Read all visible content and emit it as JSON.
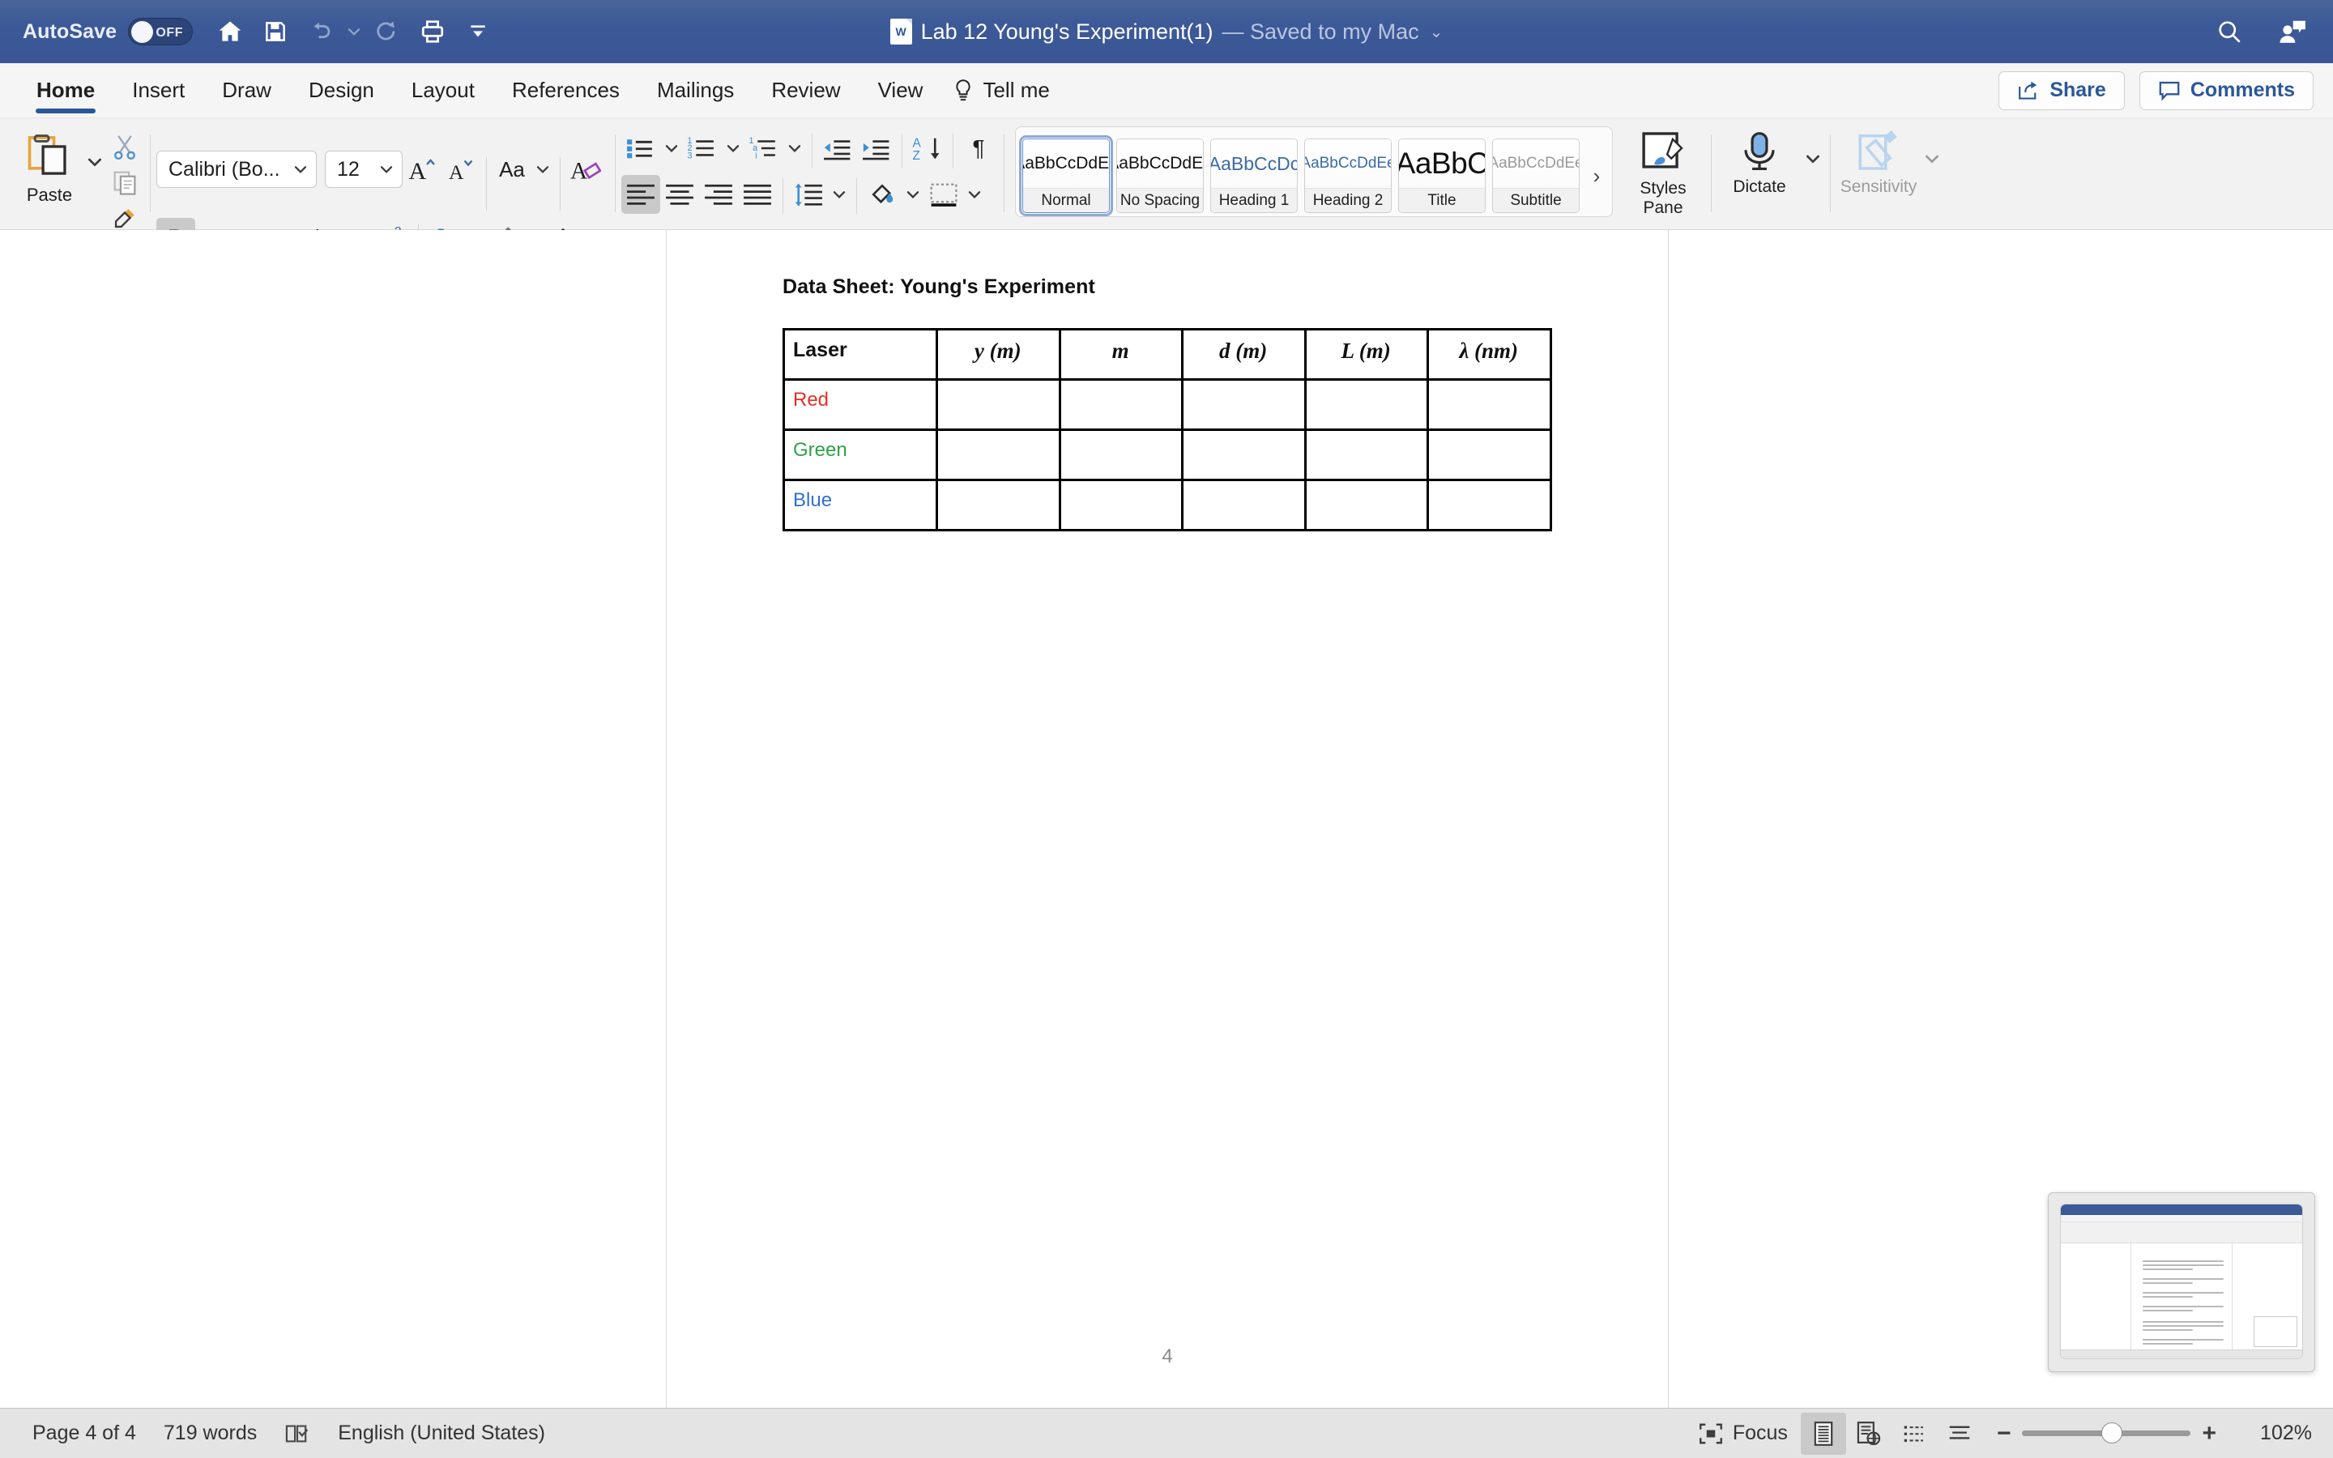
{
  "titlebar": {
    "autosave_label": "AutoSave",
    "autosave_state": "OFF",
    "quick_access": [
      {
        "name": "home-icon",
        "label": "Home"
      },
      {
        "name": "save-icon",
        "label": "Save"
      },
      {
        "name": "undo-icon",
        "label": "Undo"
      },
      {
        "name": "redo-icon",
        "label": "Redo"
      },
      {
        "name": "print-icon",
        "label": "Print"
      },
      {
        "name": "customize-toolbar-icon",
        "label": "Customize Quick Access Toolbar"
      }
    ],
    "doc_icon_letter": "W",
    "doc_title": "Lab 12 Young's Experiment(1)",
    "save_status": " — Saved to my Mac",
    "title_caret": "⌄",
    "search_icon": "search-icon",
    "account_icon": "account-presence-icon"
  },
  "ribbon_tabs": {
    "items": [
      {
        "label": "Home",
        "active": true
      },
      {
        "label": "Insert",
        "active": false
      },
      {
        "label": "Draw",
        "active": false
      },
      {
        "label": "Design",
        "active": false
      },
      {
        "label": "Layout",
        "active": false
      },
      {
        "label": "References",
        "active": false
      },
      {
        "label": "Mailings",
        "active": false
      },
      {
        "label": "Review",
        "active": false
      },
      {
        "label": "View",
        "active": false
      }
    ],
    "tell_me": "Tell me",
    "share_label": "Share",
    "comments_label": "Comments"
  },
  "ribbon": {
    "paste_label": "Paste",
    "font_name": "Calibri (Bo...",
    "font_size": "12",
    "bold_active": true,
    "align_left_active": true,
    "styles": [
      {
        "preview": "AaBbCcDdEe",
        "name": "Normal",
        "selected": true,
        "kind": "normal"
      },
      {
        "preview": "AaBbCcDdEe",
        "name": "No Spacing",
        "selected": false,
        "kind": "nospacing"
      },
      {
        "preview": "AaBbCcDc",
        "name": "Heading 1",
        "selected": false,
        "kind": "h1"
      },
      {
        "preview": "AaBbCcDdEe",
        "name": "Heading 2",
        "selected": false,
        "kind": "h2"
      },
      {
        "preview": "AaBbC",
        "name": "Title",
        "selected": false,
        "kind": "title"
      },
      {
        "preview": "AaBbCcDdEe",
        "name": "Subtitle",
        "selected": false,
        "kind": "subtitle"
      }
    ],
    "styles_pane_label": "Styles Pane",
    "dictate_label": "Dictate",
    "sensitivity_label": "Sensitivity"
  },
  "document": {
    "heading": "Data Sheet: Young's Experiment",
    "page_number": "4",
    "table": {
      "columns": [
        "Laser",
        "y (m)",
        "m",
        "d (m)",
        "L (m)",
        "λ (nm)"
      ],
      "rows": [
        {
          "laser": "Red",
          "color": "#e03127",
          "cells": [
            "",
            "",
            "",
            "",
            ""
          ]
        },
        {
          "laser": "Green",
          "color": "#2fa04a",
          "cells": [
            "",
            "",
            "",
            "",
            ""
          ]
        },
        {
          "laser": "Blue",
          "color": "#2f6fd0",
          "cells": [
            "",
            "",
            "",
            "",
            ""
          ]
        }
      ]
    }
  },
  "statusbar": {
    "page_indicator": "Page 4 of 4",
    "word_count": "719 words",
    "proofing_icon": "proofing-check-icon",
    "language": "English (United States)",
    "focus_label": "Focus",
    "view_print_layout": "print-layout-icon",
    "view_web_layout": "web-layout-icon",
    "view_outline": "outline-view-icon",
    "view_draft": "draft-view-icon",
    "zoom_out": "−",
    "zoom_in": "+",
    "zoom_level": "102%"
  },
  "colors": {
    "titlebar": "#3c5998",
    "accent": "#2b579a",
    "ribbon_bg": "#f2f2f2",
    "statusbar_bg": "#e4e4e4"
  }
}
